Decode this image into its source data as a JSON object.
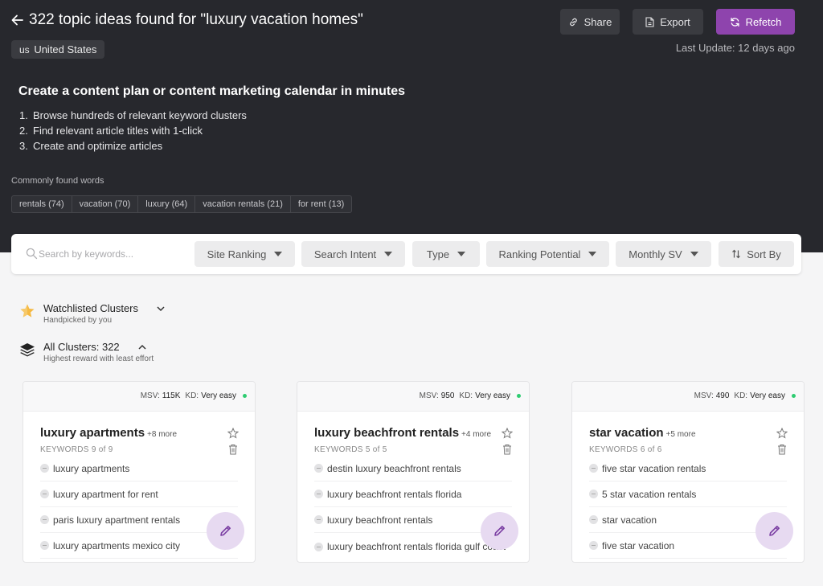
{
  "header": {
    "title": "322 topic ideas found for \"luxury vacation homes\"",
    "country_code": "us",
    "country": "United States",
    "share_label": "Share",
    "export_label": "Export",
    "refetch_label": "Refetch",
    "last_update": "Last Update: 12 days ago"
  },
  "promo": {
    "heading": "Create a content plan or content marketing calendar in minutes",
    "steps": [
      {
        "n": "1.",
        "text": "Browse hundreds of relevant keyword clusters"
      },
      {
        "n": "2.",
        "text": "Find relevant article titles with 1-click"
      },
      {
        "n": "3.",
        "text": "Create and optimize articles"
      }
    ]
  },
  "common_words": {
    "label": "Commonly found words",
    "chips": [
      "rentals (74)",
      "vacation (70)",
      "luxury (64)",
      "vacation rentals (21)",
      "for rent (13)"
    ]
  },
  "filters": {
    "search_placeholder": "Search by keywords...",
    "site_ranking": "Site Ranking",
    "search_intent": "Search Intent",
    "type": "Type",
    "ranking_potential": "Ranking Potential",
    "monthly_sv": "Monthly SV",
    "sort_by": "Sort By"
  },
  "sections": {
    "watchlisted": {
      "title": "Watchlisted Clusters",
      "subtitle": "Handpicked by you"
    },
    "all": {
      "title": "All Clusters: 322",
      "subtitle": "Highest reward with least effort"
    }
  },
  "cards": [
    {
      "msv_label": "MSV:",
      "msv": "115K",
      "kd_label": "KD:",
      "kd": "Very easy",
      "title": "luxury apartments",
      "more": "+8 more",
      "keywords_count": "KEYWORDS 9 of 9",
      "keywords": [
        "luxury apartments",
        "luxury apartment for rent",
        "paris luxury apartment rentals",
        "luxury apartments mexico city"
      ]
    },
    {
      "msv_label": "MSV:",
      "msv": "950",
      "kd_label": "KD:",
      "kd": "Very easy",
      "title": "luxury beachfront rentals",
      "more": "+4 more",
      "keywords_count": "KEYWORDS 5 of 5",
      "keywords": [
        "destin luxury beachfront rentals",
        "luxury beachfront rentals florida",
        "luxury beachfront rentals",
        "luxury beachfront rentals florida gulf coast"
      ]
    },
    {
      "msv_label": "MSV:",
      "msv": "490",
      "kd_label": "KD:",
      "kd": "Very easy",
      "title": "star vacation",
      "more": "+5 more",
      "keywords_count": "KEYWORDS 6 of 6",
      "keywords": [
        "five star vacation rentals",
        "5 star vacation rentals",
        "star vacation",
        "five star vacation"
      ]
    }
  ],
  "colors": {
    "header_bg": "#27282d",
    "accent": "#8e44ad",
    "difficulty_dot": "#2ecc71"
  }
}
